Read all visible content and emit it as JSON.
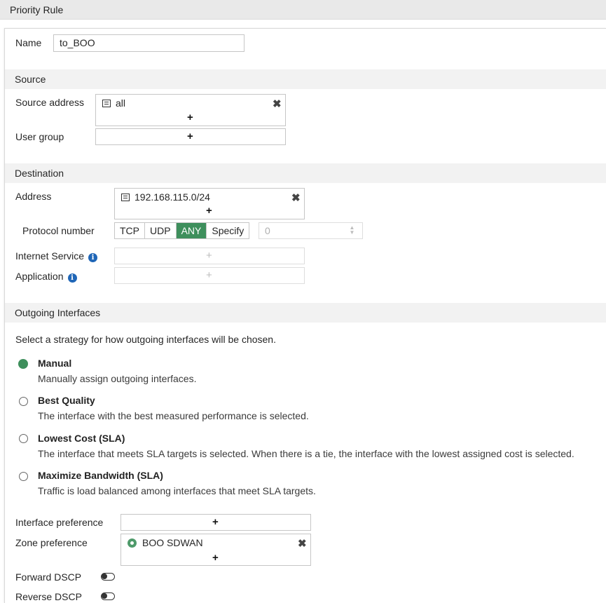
{
  "title": "Priority Rule",
  "name": {
    "label": "Name",
    "value": "to_BOO"
  },
  "source": {
    "heading": "Source",
    "address_label": "Source address",
    "address_entry": "all",
    "user_group_label": "User group"
  },
  "destination": {
    "heading": "Destination",
    "address_label": "Address",
    "address_entry": "192.168.115.0/24",
    "protocol_label": "Protocol number",
    "protocol_options": [
      "TCP",
      "UDP",
      "ANY",
      "Specify"
    ],
    "protocol_selected": "ANY",
    "protocol_value": "0",
    "internet_service_label": "Internet Service",
    "application_label": "Application"
  },
  "outgoing": {
    "heading": "Outgoing Interfaces",
    "intro": "Select a strategy for how outgoing interfaces will be chosen.",
    "strategies": [
      {
        "title": "Manual",
        "desc": "Manually assign outgoing interfaces.",
        "selected": true
      },
      {
        "title": "Best Quality",
        "desc": "The interface with the best measured performance is selected.",
        "selected": false
      },
      {
        "title": "Lowest Cost (SLA)",
        "desc": "The interface that meets SLA targets is selected. When there is a tie, the interface with the lowest assigned cost is selected.",
        "selected": false
      },
      {
        "title": "Maximize Bandwidth (SLA)",
        "desc": "Traffic is load balanced among interfaces that meet SLA targets.",
        "selected": false
      }
    ],
    "interface_pref_label": "Interface preference",
    "zone_pref_label": "Zone preference",
    "zone_entry": "BOO SDWAN"
  },
  "forward_dscp_label": "Forward DSCP",
  "reverse_dscp_label": "Reverse DSCP",
  "colors": {
    "accent": "#3e8f5c",
    "info": "#1f66b7"
  },
  "icons": {
    "add": "plus-icon",
    "remove": "close-icon",
    "address": "address-object-icon",
    "zone": "zone-icon",
    "info": "info-icon"
  }
}
